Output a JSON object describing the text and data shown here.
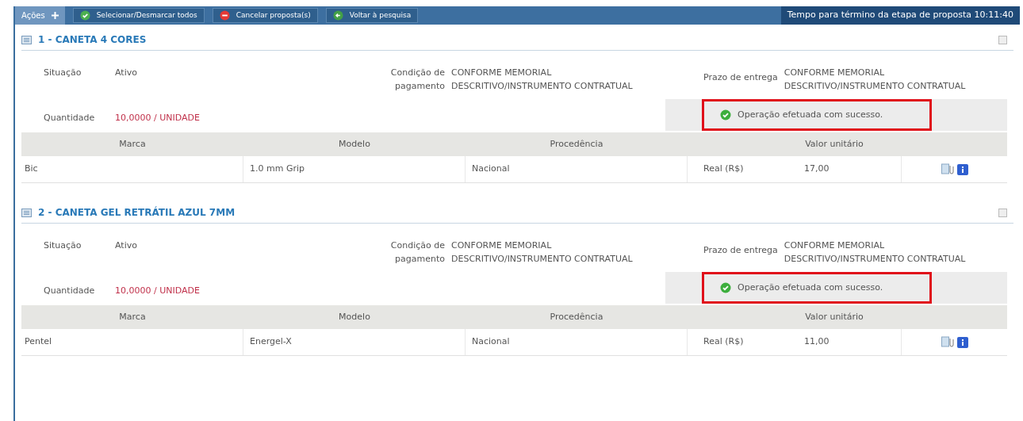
{
  "toolbar": {
    "menu_label": "Ações",
    "buttons": [
      {
        "label": "Selecionar/Desmarcar todos",
        "kind": "check"
      },
      {
        "label": "Cancelar proposta(s)",
        "kind": "cancel"
      },
      {
        "label": "Voltar à pesquisa",
        "kind": "back"
      }
    ],
    "timer": "Tempo para término da etapa de proposta 10:11:40"
  },
  "items": [
    {
      "title": "1 - CANETA 4 CORES",
      "checked": false,
      "fields": {
        "situacao_label": "Situação",
        "situacao": "Ativo",
        "quantidade_label": "Quantidade",
        "quantidade": "10,0000 / UNIDADE",
        "condicao_label": "Condição de pagamento",
        "condicao": "CONFORME MEMORIAL DESCRITIVO/INSTRUMENTO CONTRATUAL",
        "prazo_label": "Prazo de entrega",
        "prazo": "CONFORME MEMORIAL DESCRITIVO/INSTRUMENTO CONTRATUAL"
      },
      "message": "Operação efetuada com sucesso.",
      "highlighted": true,
      "columns": [
        "Marca",
        "Modelo",
        "Procedência",
        "Valor unitário"
      ],
      "row": {
        "marca": "Bic",
        "modelo": "1.0 mm Grip",
        "procedencia": "Nacional",
        "moeda": "Real (R$)",
        "valor": "17,00"
      }
    },
    {
      "title": "2 - CANETA GEL RETRÁTIL AZUL 7MM",
      "checked": false,
      "fields": {
        "situacao_label": "Situação",
        "situacao": "Ativo",
        "quantidade_label": "Quantidade",
        "quantidade": "10,0000 / UNIDADE",
        "condicao_label": "Condição de pagamento",
        "condicao": "CONFORME MEMORIAL DESCRITIVO/INSTRUMENTO CONTRATUAL",
        "prazo_label": "Prazo de entrega",
        "prazo": "CONFORME MEMORIAL DESCRITIVO/INSTRUMENTO CONTRATUAL"
      },
      "message": "Operação efetuada com sucesso.",
      "highlighted": true,
      "columns": [
        "Marca",
        "Modelo",
        "Procedência",
        "Valor unitário"
      ],
      "row": {
        "marca": "Pentel",
        "modelo": "Energel-X",
        "procedencia": "Nacional",
        "moeda": "Real (R$)",
        "valor": "11,00"
      }
    }
  ]
}
